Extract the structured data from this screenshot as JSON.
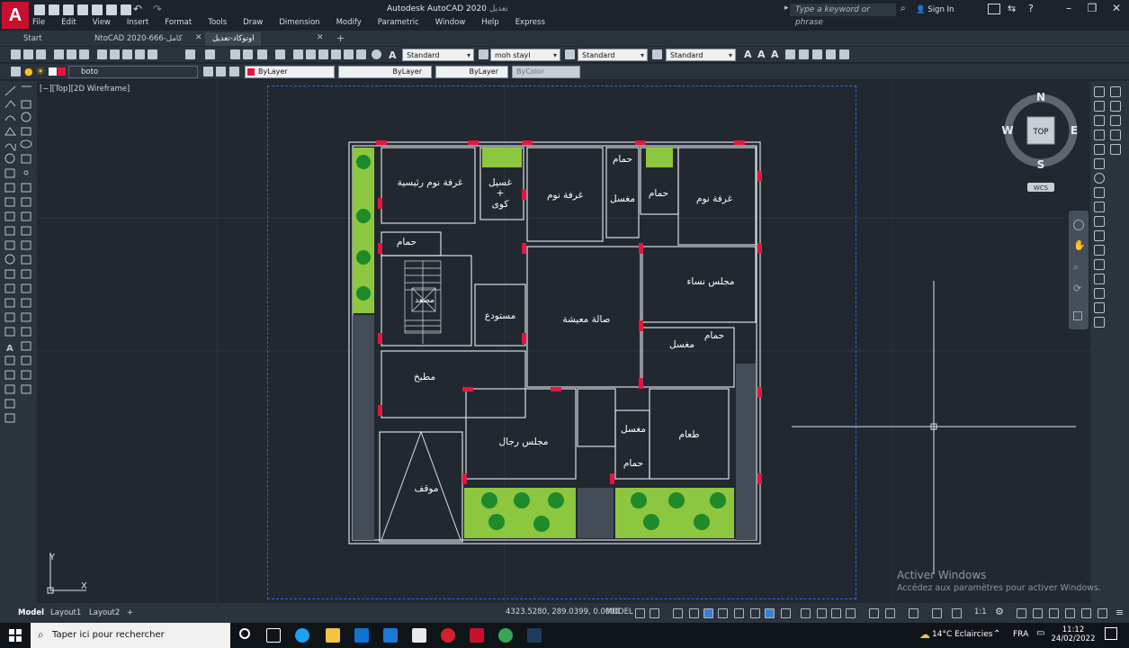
{
  "window": {
    "title": "Autodesk AutoCAD 2020",
    "title_suffix": "تعديل",
    "search_placeholder": "Type a keyword or phrase",
    "sign_in": "Sign In",
    "logo_letter": "A"
  },
  "menu": [
    "File",
    "Edit",
    "View",
    "Insert",
    "Format",
    "Tools",
    "Draw",
    "Dimension",
    "Modify",
    "Parametric",
    "Window",
    "Help",
    "Express"
  ],
  "tabs": [
    {
      "label": "Start"
    },
    {
      "label": "NtoCAD 2020-666-كامل"
    },
    {
      "label": "اوتوكاد-تعديل"
    }
  ],
  "styles_toolbar": {
    "text_style": "Standard",
    "dim_style": "moh stayl",
    "table_style": "Standard",
    "mleader_style": "Standard"
  },
  "layers_toolbar": {
    "layer": "boto",
    "color": "ByLayer",
    "linetype": "ByLayer",
    "lineweight": "ByLayer",
    "plotstyle": "ByColor"
  },
  "viewport": {
    "label": "[−][Top][2D Wireframe]"
  },
  "viewcube": {
    "north": "N",
    "south": "S",
    "east": "E",
    "west": "W",
    "top": "TOP",
    "wcs": "WCS"
  },
  "ucs": {
    "x": "X",
    "y": "Y"
  },
  "rooms": [
    {
      "name": "غرفة نوم رئيسية"
    },
    {
      "name": "غسيل"
    },
    {
      "name": "+"
    },
    {
      "name": "كوى"
    },
    {
      "name": "غرفة نوم"
    },
    {
      "name": "حمام"
    },
    {
      "name": "مغسل"
    },
    {
      "name": "حمام"
    },
    {
      "name": "غرفة نوم"
    },
    {
      "name": "حمام"
    },
    {
      "name": "مصعد"
    },
    {
      "name": "مستودع"
    },
    {
      "name": "صالة معيشة"
    },
    {
      "name": "مجلس نساء"
    },
    {
      "name": "حمام"
    },
    {
      "name": "مغسل"
    },
    {
      "name": "مطبخ"
    },
    {
      "name": "مجلس رجال"
    },
    {
      "name": "مغسل"
    },
    {
      "name": "طعام"
    },
    {
      "name": "حمام"
    },
    {
      "name": "موقف"
    }
  ],
  "layout_tabs": [
    "Model",
    "Layout1",
    "Layout2",
    "+"
  ],
  "status": {
    "coords": "4323.5280, 289.0399, 0.0000",
    "model": "MODEL",
    "scale": "1:1"
  },
  "watermark": {
    "line1": "Activer Windows",
    "line2": "Accédez aux paramètres pour activer Windows."
  },
  "taskbar": {
    "search_placeholder": "Taper ici pour rechercher",
    "weather": "14°C  Eclaircies",
    "lang": "FRA",
    "time": "11:12",
    "date": "24/02/2022"
  },
  "colors": {
    "accent_red": "#c8102e",
    "wall": "#d9dde2",
    "door_red": "#e8153a",
    "garden": "#8dc63f",
    "tree": "#1f8a2a",
    "sheet_border": "#2a5fff",
    "canvas": "#212830"
  }
}
